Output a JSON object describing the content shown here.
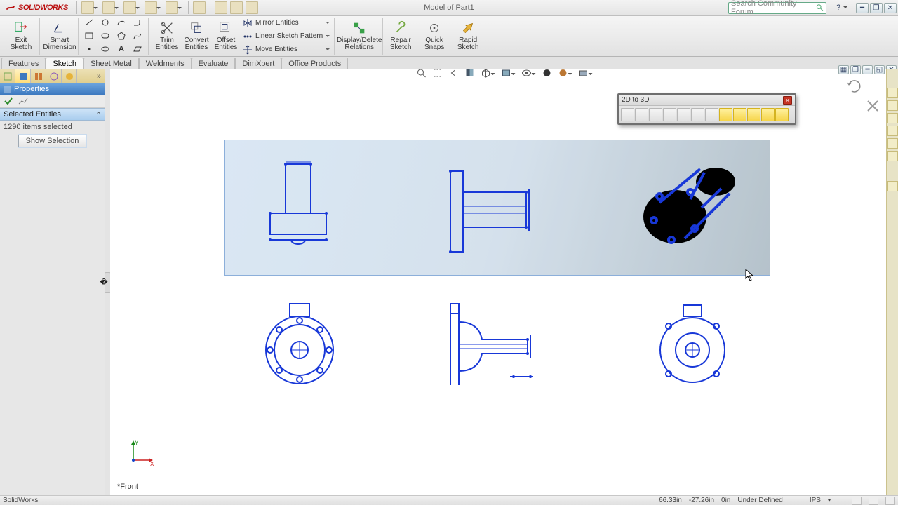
{
  "app": {
    "name": "SOLIDWORKS",
    "doc_title": "Model of Part1"
  },
  "search": {
    "placeholder": "Search Community Forum"
  },
  "ribbon": {
    "exit_sketch": "Exit\nSketch",
    "smart_dim": "Smart\nDimension",
    "trim": "Trim\nEntities",
    "convert": "Convert\nEntities",
    "offset": "Offset\nEntities",
    "mirror": "Mirror Entities",
    "pattern": "Linear Sketch Pattern",
    "move": "Move Entities",
    "disp_del": "Display/Delete\nRelations",
    "repair": "Repair\nSketch",
    "quick_snaps": "Quick\nSnaps",
    "rapid": "Rapid\nSketch"
  },
  "tabs": [
    "Features",
    "Sketch",
    "Sheet Metal",
    "Weldments",
    "Evaluate",
    "DimXpert",
    "Office Products"
  ],
  "active_tab": "Sketch",
  "props": {
    "title": "Properties",
    "section": "Selected Entities",
    "count_text": "1290 items selected",
    "show_btn": "Show Selection"
  },
  "toolbar2d3d": {
    "title": "2D to 3D"
  },
  "view_label": "*Front",
  "status": {
    "app": "SolidWorks",
    "coord_x": "66.33in",
    "coord_y": "-27.26in",
    "coord_z": "0in",
    "defined": "Under Defined",
    "units": "IPS"
  }
}
